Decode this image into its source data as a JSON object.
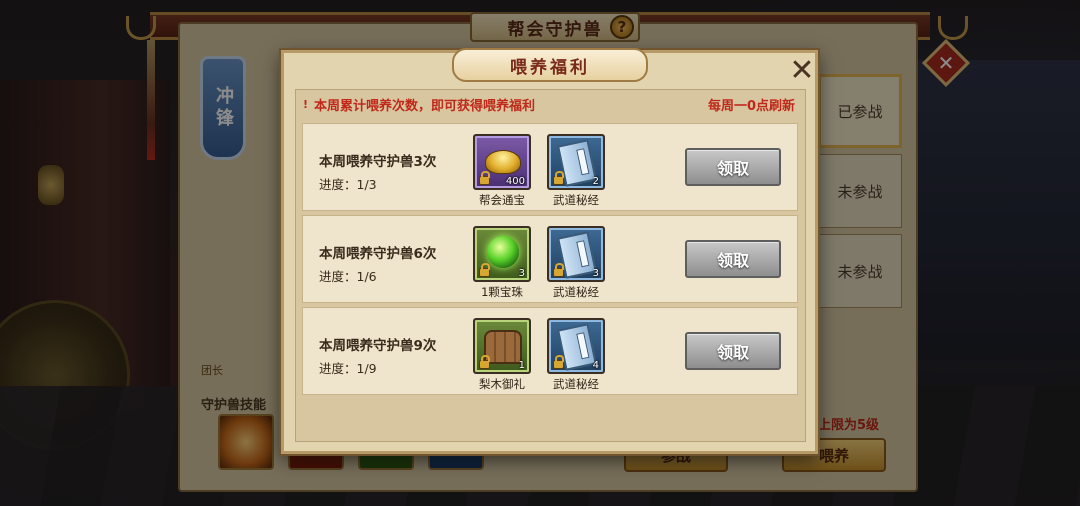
{
  "back_panel": {
    "title": "帮会守护兽",
    "help_icon": "?",
    "banner": "冲锋",
    "side_tabs": [
      "已参战",
      "未参战",
      "未参战"
    ],
    "leader_label": "团长",
    "skill_label": "守护兽技能",
    "level_note": "上限为5级",
    "join_button": "参战",
    "feed_button": "喂养"
  },
  "popup": {
    "title": "喂养福利",
    "close_icon": "✕",
    "notice_icon": "!",
    "notice": "本周累计喂养次数，即可获得喂养福利",
    "refresh": "每周一0点刷新",
    "rows": [
      {
        "title": "本周喂养守护兽3次",
        "progress": "进度：1/3",
        "items": [
          {
            "name": "帮会通宝",
            "count": "400",
            "icon": "gold-ingot-icon",
            "rarity": "purple"
          },
          {
            "name": "武道秘经",
            "count": "2",
            "icon": "scripture-book-icon",
            "rarity": "blue"
          }
        ],
        "button": "领取"
      },
      {
        "title": "本周喂养守护兽6次",
        "progress": "进度：1/6",
        "items": [
          {
            "name": "1颗宝珠",
            "count": "3",
            "icon": "jade-orb-icon",
            "rarity": "green"
          },
          {
            "name": "武道秘经",
            "count": "3",
            "icon": "scripture-book-icon",
            "rarity": "blue"
          }
        ],
        "button": "领取"
      },
      {
        "title": "本周喂养守护兽9次",
        "progress": "进度：1/9",
        "items": [
          {
            "name": "梨木御礼",
            "count": "1",
            "icon": "wooden-chest-icon",
            "rarity": "green"
          },
          {
            "name": "武道秘经",
            "count": "4",
            "icon": "scripture-book-icon",
            "rarity": "blue"
          }
        ],
        "button": "领取"
      }
    ]
  },
  "colors": {
    "accent_red": "#c0281a",
    "panel_bg": "#e3d4b0",
    "button_gray": "#8e8e8e"
  }
}
